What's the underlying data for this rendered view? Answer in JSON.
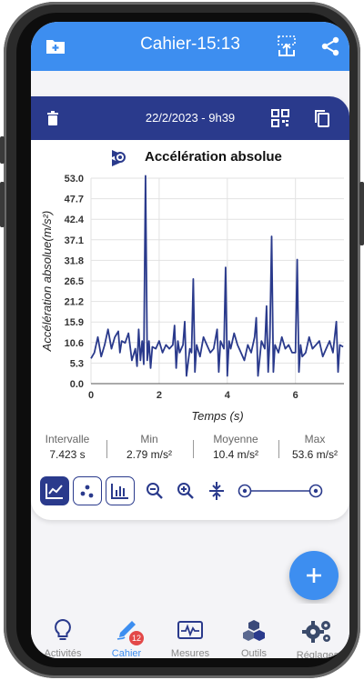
{
  "appbar": {
    "title": "Cahier-15:13"
  },
  "card": {
    "date": "22/2/2023 - 9h39"
  },
  "chart_data": {
    "type": "line",
    "title": "Accélération absolue",
    "xlabel": "Temps (s)",
    "ylabel": "Accélération absolue(m/s²)",
    "ylim": [
      0,
      53
    ],
    "xlim": [
      0,
      7.423
    ],
    "yticks": [
      "0.0",
      "5.3",
      "10.6",
      "15.9",
      "21.2",
      "26.5",
      "31.8",
      "37.1",
      "42.4",
      "47.7",
      "53.0"
    ],
    "xticks": [
      "0",
      "2",
      "4",
      "6"
    ],
    "grid": true,
    "series": [
      {
        "x": [
          0,
          0.1,
          0.2,
          0.3,
          0.4,
          0.5,
          0.6,
          0.7,
          0.8,
          0.85,
          0.9,
          1.0,
          1.1,
          1.2,
          1.3,
          1.35,
          1.4,
          1.45,
          1.5,
          1.55,
          1.6,
          1.65,
          1.7,
          1.75,
          1.8,
          1.9,
          2.0,
          2.1,
          2.2,
          2.3,
          2.4,
          2.45,
          2.5,
          2.55,
          2.6,
          2.7,
          2.75,
          2.8,
          2.9,
          2.95,
          3.0,
          3.05,
          3.1,
          3.2,
          3.3,
          3.4,
          3.5,
          3.6,
          3.7,
          3.75,
          3.8,
          3.9,
          3.95,
          4.0,
          4.05,
          4.1,
          4.2,
          4.3,
          4.4,
          4.5,
          4.6,
          4.7,
          4.8,
          4.85,
          4.9,
          5.0,
          5.1,
          5.15,
          5.2,
          5.25,
          5.3,
          5.35,
          5.4,
          5.5,
          5.6,
          5.7,
          5.8,
          5.9,
          6.0,
          6.05,
          6.1,
          6.15,
          6.2,
          6.3,
          6.4,
          6.5,
          6.6,
          6.7,
          6.8,
          6.9,
          7.0,
          7.1,
          7.2,
          7.25,
          7.3,
          7.4
        ],
        "y": [
          6.5,
          8,
          12,
          7,
          10,
          14,
          9,
          12,
          13.5,
          8,
          11,
          10.5,
          13,
          6,
          9,
          4.5,
          14,
          6,
          11,
          5,
          53.6,
          6,
          11,
          4,
          9.5,
          9,
          11,
          8,
          10,
          9,
          10,
          15,
          4,
          11,
          8,
          10,
          16,
          2,
          9,
          8,
          27,
          3,
          10,
          7,
          12,
          10,
          8,
          9,
          14,
          3,
          11,
          9,
          30,
          2,
          11,
          9,
          13,
          10,
          8,
          6,
          10,
          8,
          12,
          17,
          2,
          11,
          9,
          20,
          3,
          12,
          38,
          3,
          10,
          8,
          12,
          9,
          10,
          8,
          8,
          32,
          3,
          10,
          7,
          8,
          12,
          9,
          10,
          11,
          7,
          9,
          11,
          8,
          16,
          3,
          10,
          9.5
        ]
      }
    ]
  },
  "stats": [
    {
      "label": "Intervalle",
      "value": "7.423 s"
    },
    {
      "label": "Min",
      "value": "2.79 m/s²"
    },
    {
      "label": "Moyenne",
      "value": "10.4 m/s²"
    },
    {
      "label": "Max",
      "value": "53.6 m/s²"
    }
  ],
  "nav": [
    {
      "label": "Activités",
      "icon": "lightbulb-icon"
    },
    {
      "label": "Cahier",
      "icon": "pen-icon",
      "badge": "12"
    },
    {
      "label": "Mesures",
      "icon": "waveform-icon"
    },
    {
      "label": "Outils",
      "icon": "boxes-icon"
    },
    {
      "label": "Réglages",
      "icon": "gears-icon"
    }
  ],
  "colors": {
    "appbar": "#3d8ef0",
    "cardhead": "#2a3a8c",
    "line": "#2a3a8c",
    "badge": "#e34848"
  }
}
